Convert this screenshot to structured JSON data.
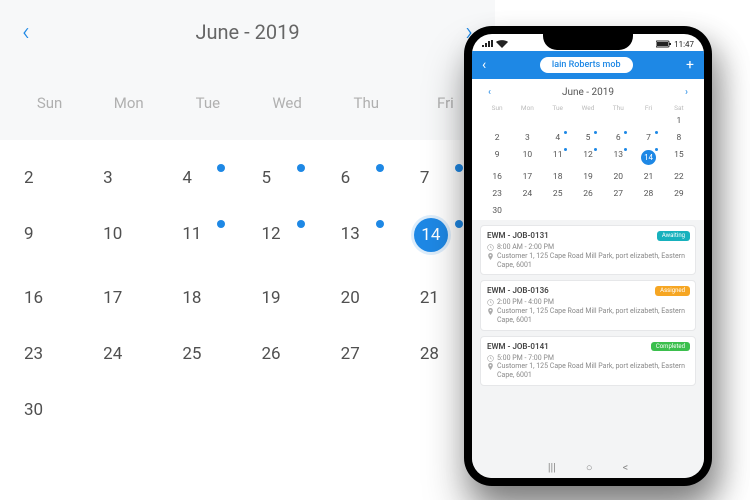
{
  "big_calendar": {
    "title": "June - 2019",
    "dow": [
      "Sun",
      "Mon",
      "Tue",
      "Wed",
      "Thu",
      "Fri"
    ],
    "rows": [
      [
        {
          "n": "2"
        },
        {
          "n": "3"
        },
        {
          "n": "4",
          "d": 1
        },
        {
          "n": "5",
          "d": 1
        },
        {
          "n": "6",
          "d": 1
        },
        {
          "n": "7",
          "d": 1
        }
      ],
      [
        {
          "n": "9"
        },
        {
          "n": "10"
        },
        {
          "n": "11",
          "d": 1
        },
        {
          "n": "12",
          "d": 1
        },
        {
          "n": "13",
          "d": 1
        },
        {
          "n": "14",
          "d": 1,
          "sel": 1
        }
      ],
      [
        {
          "n": "16"
        },
        {
          "n": "17"
        },
        {
          "n": "18"
        },
        {
          "n": "19"
        },
        {
          "n": "20"
        },
        {
          "n": "21"
        }
      ],
      [
        {
          "n": "23"
        },
        {
          "n": "24"
        },
        {
          "n": "25"
        },
        {
          "n": "26"
        },
        {
          "n": "27"
        },
        {
          "n": "28"
        }
      ],
      [
        {
          "n": "30"
        },
        {
          "n": ""
        },
        {
          "n": ""
        },
        {
          "n": ""
        },
        {
          "n": ""
        },
        {
          "n": ""
        }
      ]
    ]
  },
  "phone": {
    "status_time": "11:47",
    "header_chip": "Iain Roberts mob",
    "mini_title": "June - 2019",
    "mini_dow": [
      "Sun",
      "Mon",
      "Tue",
      "Wed",
      "Thu",
      "Fri",
      "Sat"
    ],
    "mini_rows": [
      [
        {
          "n": ""
        },
        {
          "n": ""
        },
        {
          "n": ""
        },
        {
          "n": ""
        },
        {
          "n": ""
        },
        {
          "n": ""
        },
        {
          "n": "1"
        }
      ],
      [
        {
          "n": "2"
        },
        {
          "n": "3"
        },
        {
          "n": "4",
          "d": 1
        },
        {
          "n": "5",
          "d": 1
        },
        {
          "n": "6",
          "d": 1
        },
        {
          "n": "7",
          "d": 1
        },
        {
          "n": "8"
        }
      ],
      [
        {
          "n": "9"
        },
        {
          "n": "10"
        },
        {
          "n": "11",
          "d": 1
        },
        {
          "n": "12",
          "d": 1
        },
        {
          "n": "13",
          "d": 1
        },
        {
          "n": "14",
          "d": 1,
          "sel": 1
        },
        {
          "n": "15"
        }
      ],
      [
        {
          "n": "16"
        },
        {
          "n": "17"
        },
        {
          "n": "18"
        },
        {
          "n": "19"
        },
        {
          "n": "20"
        },
        {
          "n": "21"
        },
        {
          "n": "22"
        }
      ],
      [
        {
          "n": "23"
        },
        {
          "n": "24"
        },
        {
          "n": "25"
        },
        {
          "n": "26"
        },
        {
          "n": "27"
        },
        {
          "n": "28"
        },
        {
          "n": "29"
        }
      ],
      [
        {
          "n": "30"
        },
        {
          "n": ""
        },
        {
          "n": ""
        },
        {
          "n": ""
        },
        {
          "n": ""
        },
        {
          "n": ""
        },
        {
          "n": ""
        }
      ]
    ],
    "jobs": [
      {
        "id": "EWM - JOB-0131",
        "time": "8:00 AM - 2:00 PM",
        "loc": "Customer 1, 125 Cape Road Mill Park, port elizabeth, Eastern Cape, 6001",
        "status": "Awaiting",
        "badge": "b-teal"
      },
      {
        "id": "EWM - JOB-0136",
        "time": "2:00 PM - 4:00 PM",
        "loc": "Customer 1, 125 Cape Road Mill Park, port elizabeth, Eastern Cape, 6001",
        "status": "Assigned",
        "badge": "b-orange"
      },
      {
        "id": "EWM - JOB-0141",
        "time": "5:00 PM - 7:00 PM",
        "loc": "Customer 1, 125 Cape Road Mill Park, port elizabeth, Eastern Cape, 6001",
        "status": "Completed",
        "badge": "b-green"
      }
    ]
  }
}
